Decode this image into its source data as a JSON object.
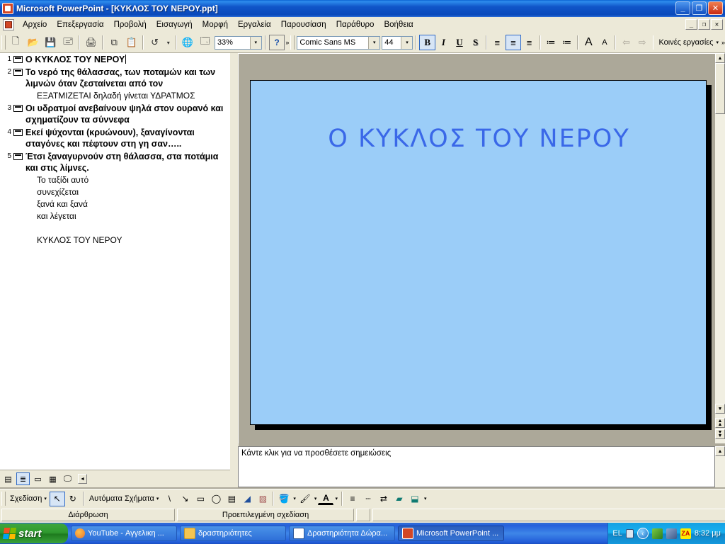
{
  "window": {
    "title": "Microsoft PowerPoint - [ΚΥΚΛΟΣ ΤΟΥ ΝΕΡΟΥ.ppt]",
    "app_icon": "powerpoint-icon",
    "minimize": "_",
    "maximize": "❐",
    "close": "✕",
    "mdi_minimize": "_",
    "mdi_restore": "❐",
    "mdi_close": "✕"
  },
  "menu": {
    "items": [
      {
        "label": "Αρχείο"
      },
      {
        "label": "Επεξεργασία"
      },
      {
        "label": "Προβολή"
      },
      {
        "label": "Εισαγωγή"
      },
      {
        "label": "Μορφή"
      },
      {
        "label": "Εργαλεία"
      },
      {
        "label": "Παρουσίαση"
      },
      {
        "label": "Παράθυρο"
      },
      {
        "label": "Βοήθεια"
      }
    ]
  },
  "toolbar": {
    "new_label": "🗋",
    "open_label": "📂",
    "save_label": "💾",
    "mail_label": "🖃",
    "print_label": "🖨",
    "copy_label": "⧉",
    "paste_label": "📋",
    "undo_label": "↺",
    "undo_arrow": "▾",
    "web_label": "🌐",
    "newslide_label": "🗔",
    "zoom_value": "33%",
    "zoom_arrow": "▾",
    "help_label": "?",
    "overflow": "»",
    "font_value": "Comic Sans MS",
    "font_arrow": "▾",
    "size_value": "44",
    "size_arrow": "▾",
    "bold_label": "B",
    "italic_label": "I",
    "underline_label": "U",
    "shadow_label": "S",
    "align_left_label": "≡",
    "align_center_label": "≡",
    "align_right_label": "≡",
    "numbering_label": "≔",
    "bullets_label": "≔",
    "increase_font_label": "A",
    "decrease_font_label": "A",
    "promote_label": "⇦",
    "demote_label": "⇨",
    "common_tasks_label": "Κοινές εργασίες",
    "common_tasks_arrow": "▾"
  },
  "outline": {
    "slides": [
      {
        "number": "1",
        "title": "Ο ΚΥΚΛΟΣ ΤΟΥ ΝΕΡΟΥ",
        "bullets": []
      },
      {
        "number": "2",
        "title": "Το νερό της θάλασσας, των ποταμών και των λιμνών όταν ζεσταίνεται από τον",
        "bullets": [
          "ΕΞΑΤΜΙΖΕΤΑΙ δηλαδή γίνεται ΥΔΡΑΤΜΟΣ"
        ]
      },
      {
        "number": "3",
        "title": "Οι υδρατμοί ανεβαίνουν ψηλά στον ουρανό και σχηματίζουν τα σύννεφα",
        "bullets": []
      },
      {
        "number": "4",
        "title": "Εκεί ψύχονται (κρυώνουν), ξαναγίνονται σταγόνες και πέφτουν στη γη σαν…..",
        "bullets": []
      },
      {
        "number": "5",
        "title": "Έτσι ξαναγυρνούν στη θάλασσα, στα ποτάμια και στις λίμνες.",
        "bullets": [
          "Το ταξίδι αυτό",
          "συνεχίζεται",
          "ξανά και ξανά",
          "και λέγεται",
          "",
          "ΚΥΚΛΟΣ ΤΟΥ ΝΕΡΟΥ"
        ]
      }
    ]
  },
  "views": {
    "normal_label": "▤",
    "outline_label": "≣",
    "slide_label": "▭",
    "sorter_label": "▦",
    "slideshow_label": "🖵",
    "scroll_left_label": "◄"
  },
  "slide": {
    "title": "Ο ΚΥΚΛΟΣ ΤΟΥ ΝΕΡΟΥ",
    "background_color": "#9BCDF8",
    "title_color": "#3A68E8"
  },
  "scrollbars": {
    "up_label": "▲",
    "down_label": "▼",
    "prev_slide_label": "▲",
    "next_slide_label": "▼"
  },
  "notes": {
    "placeholder": "Κάντε κλικ για να προσθέσετε σημειώσεις"
  },
  "draw_toolbar": {
    "draw_label": "Σχεδίαση",
    "draw_arrow": "▾",
    "select_label": "↖",
    "rotate_label": "↻",
    "autoshapes_label": "Αυτόματα Σχήματα",
    "autoshapes_arrow": "▾",
    "line_label": "\\",
    "arrow_label": "↘",
    "rect_label": "▭",
    "oval_label": "◯",
    "textbox_label": "▤",
    "wordart_label": "◢",
    "clipart_label": "▨",
    "fill_label": "🪣",
    "fill_arrow": "▾",
    "linecolor_label": "🖌",
    "linecolor_arrow": "▾",
    "fontcolor_label": "A",
    "fontcolor_arrow": "▾",
    "linestyle_label": "≡",
    "dashstyle_label": "┄",
    "arrowstyle_label": "⇄",
    "shadow_label": "▰",
    "threed_label": "⬓",
    "threed_arrow": "▾"
  },
  "status": {
    "view_name": "Διάρθρωση",
    "design_name": "Προεπιλεγμένη σχεδίαση"
  },
  "taskbar": {
    "start_label": "start",
    "items": [
      {
        "label": "YouTube - Αγγελικη ...",
        "icon": "firefox-icon",
        "icon_color": "#E8742C",
        "active": false
      },
      {
        "label": "δραστηριότητες",
        "icon": "folder-icon",
        "icon_color": "#F5C552",
        "active": false
      },
      {
        "label": "Δραστηριότητα Δώρα...",
        "icon": "word-icon",
        "icon_color": "#2A5699",
        "active": false
      },
      {
        "label": "Microsoft PowerPoint ...",
        "icon": "powerpoint-icon",
        "icon_color": "#D24726",
        "active": true
      }
    ],
    "tray": {
      "language": "EL",
      "keyboard_icon": "keyboard-icon",
      "show_hidden_label": "‹",
      "icons": [
        {
          "name": "sound-icon",
          "color": "#7AC943"
        },
        {
          "name": "network-icon",
          "color": "#5B7FB4"
        },
        {
          "name": "zonealarm-icon",
          "color": "#FFEB00"
        }
      ],
      "zonealarm_label": "ZA",
      "clock": "8:32 μμ"
    }
  }
}
